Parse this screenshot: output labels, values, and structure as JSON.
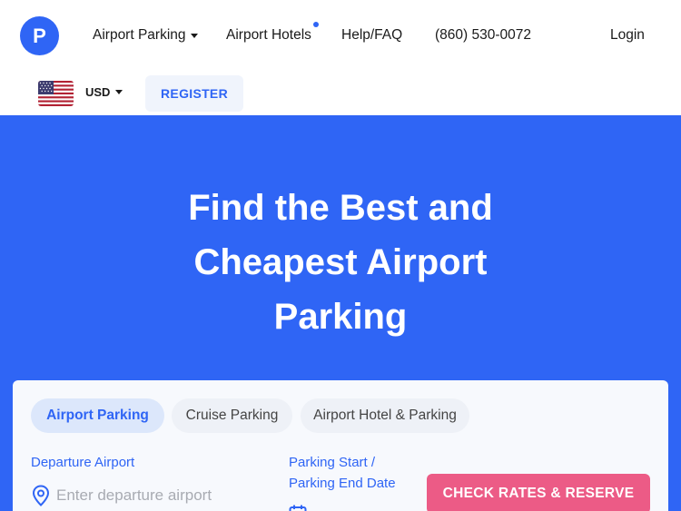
{
  "header": {
    "logo_letter": "P",
    "nav": {
      "airport_parking": "Airport Parking",
      "airport_hotels": "Airport Hotels",
      "help": "Help/FAQ",
      "phone": "(860) 530-0072",
      "login": "Login"
    },
    "currency": "USD",
    "flag_icon": "us-flag-icon",
    "register": "REGISTER"
  },
  "hero": {
    "title": "Find the Best and Cheapest Airport Parking"
  },
  "search": {
    "tabs": [
      {
        "label": "Airport Parking",
        "active": true
      },
      {
        "label": "Cruise Parking",
        "active": false
      },
      {
        "label": "Airport Hotel & Parking",
        "active": false
      }
    ],
    "departure_label": "Departure Airport",
    "departure_placeholder": "Enter departure airport",
    "dates_label": "Parking Start / Parking End Date",
    "cta": "CHECK RATES & RESERVE"
  },
  "colors": {
    "brand_blue": "#2f65f5",
    "cta_pink": "#ec5b86"
  }
}
